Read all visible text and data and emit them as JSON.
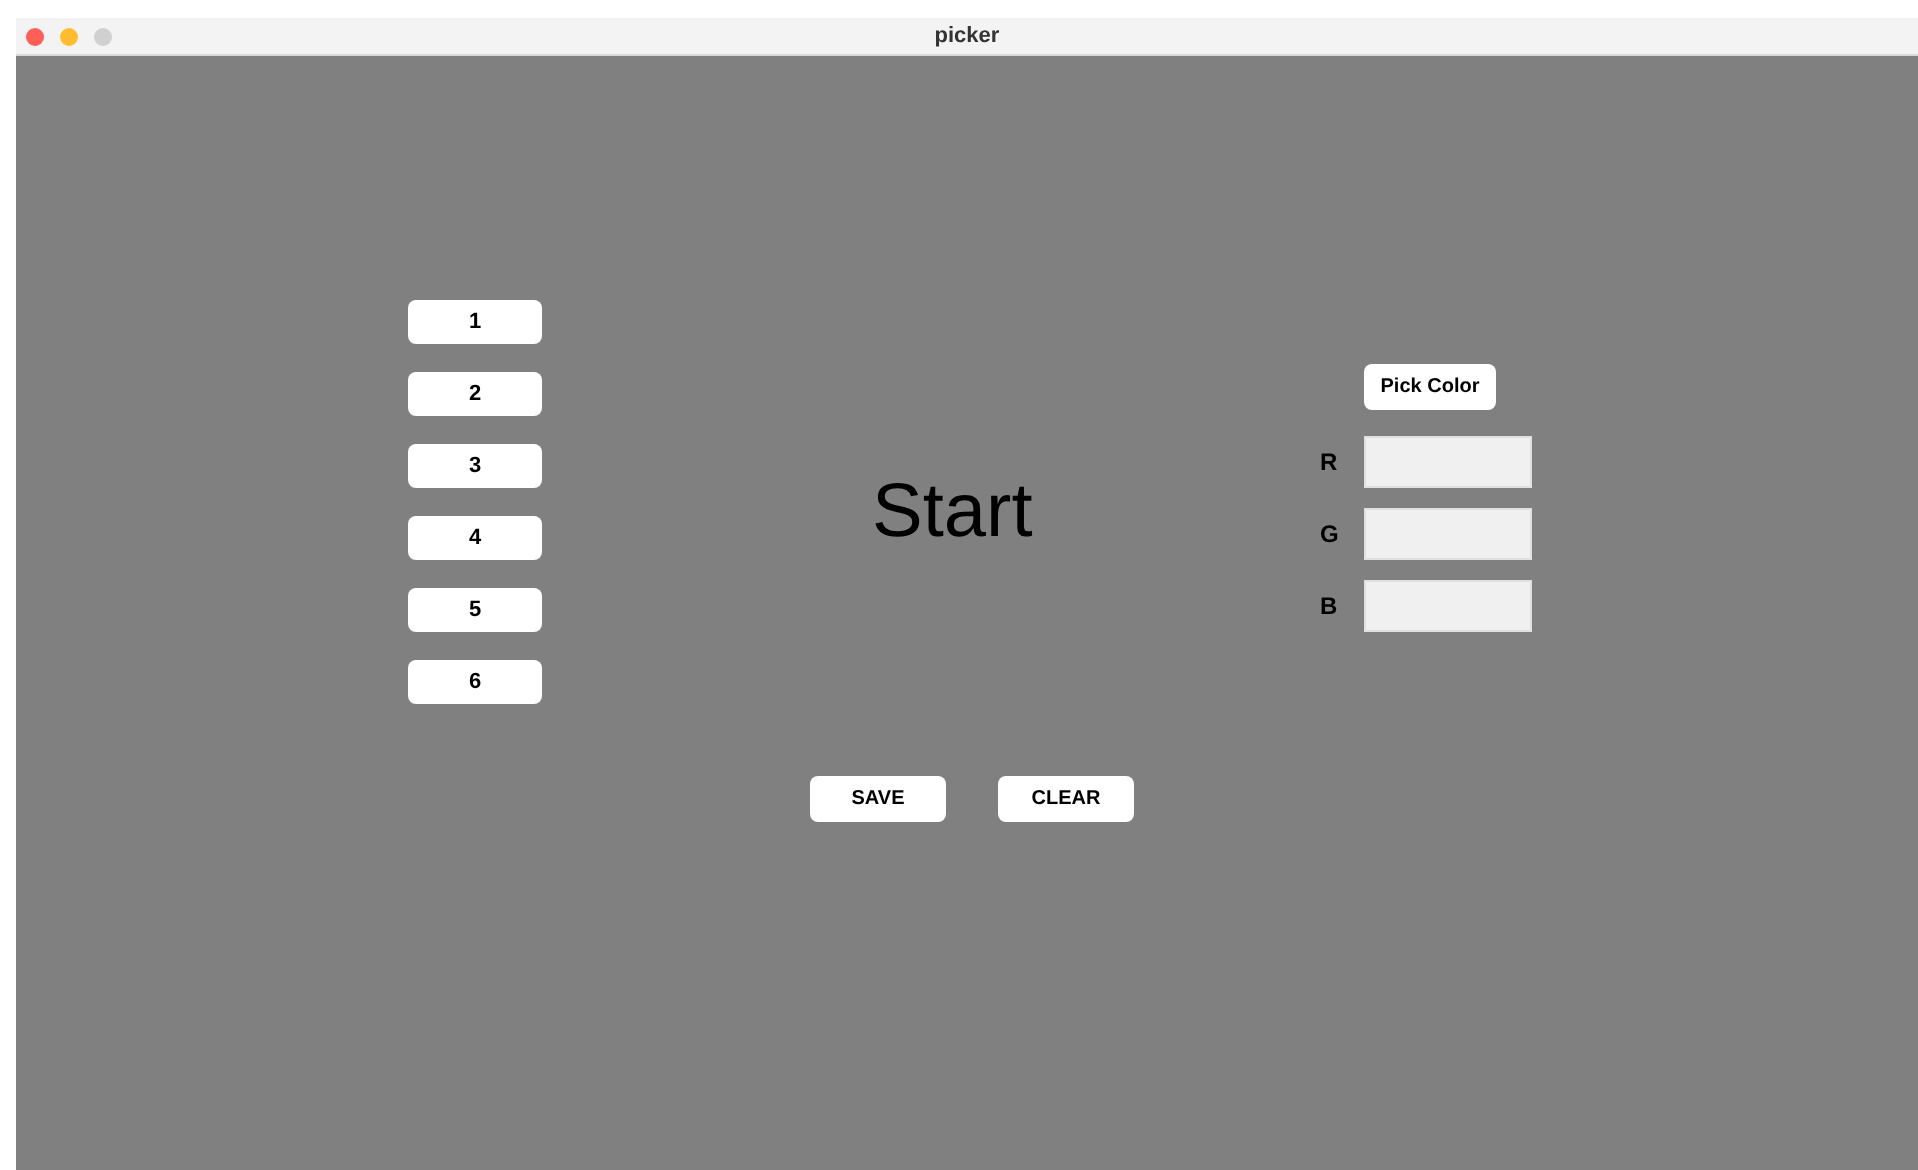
{
  "window": {
    "title": "picker"
  },
  "number_buttons": [
    "1",
    "2",
    "3",
    "4",
    "5",
    "6"
  ],
  "heading": "Start",
  "pick_button": "Pick Color",
  "channels": [
    {
      "label": "R"
    },
    {
      "label": "G"
    },
    {
      "label": "B"
    }
  ],
  "actions": [
    "SAVE",
    "CLEAR"
  ]
}
